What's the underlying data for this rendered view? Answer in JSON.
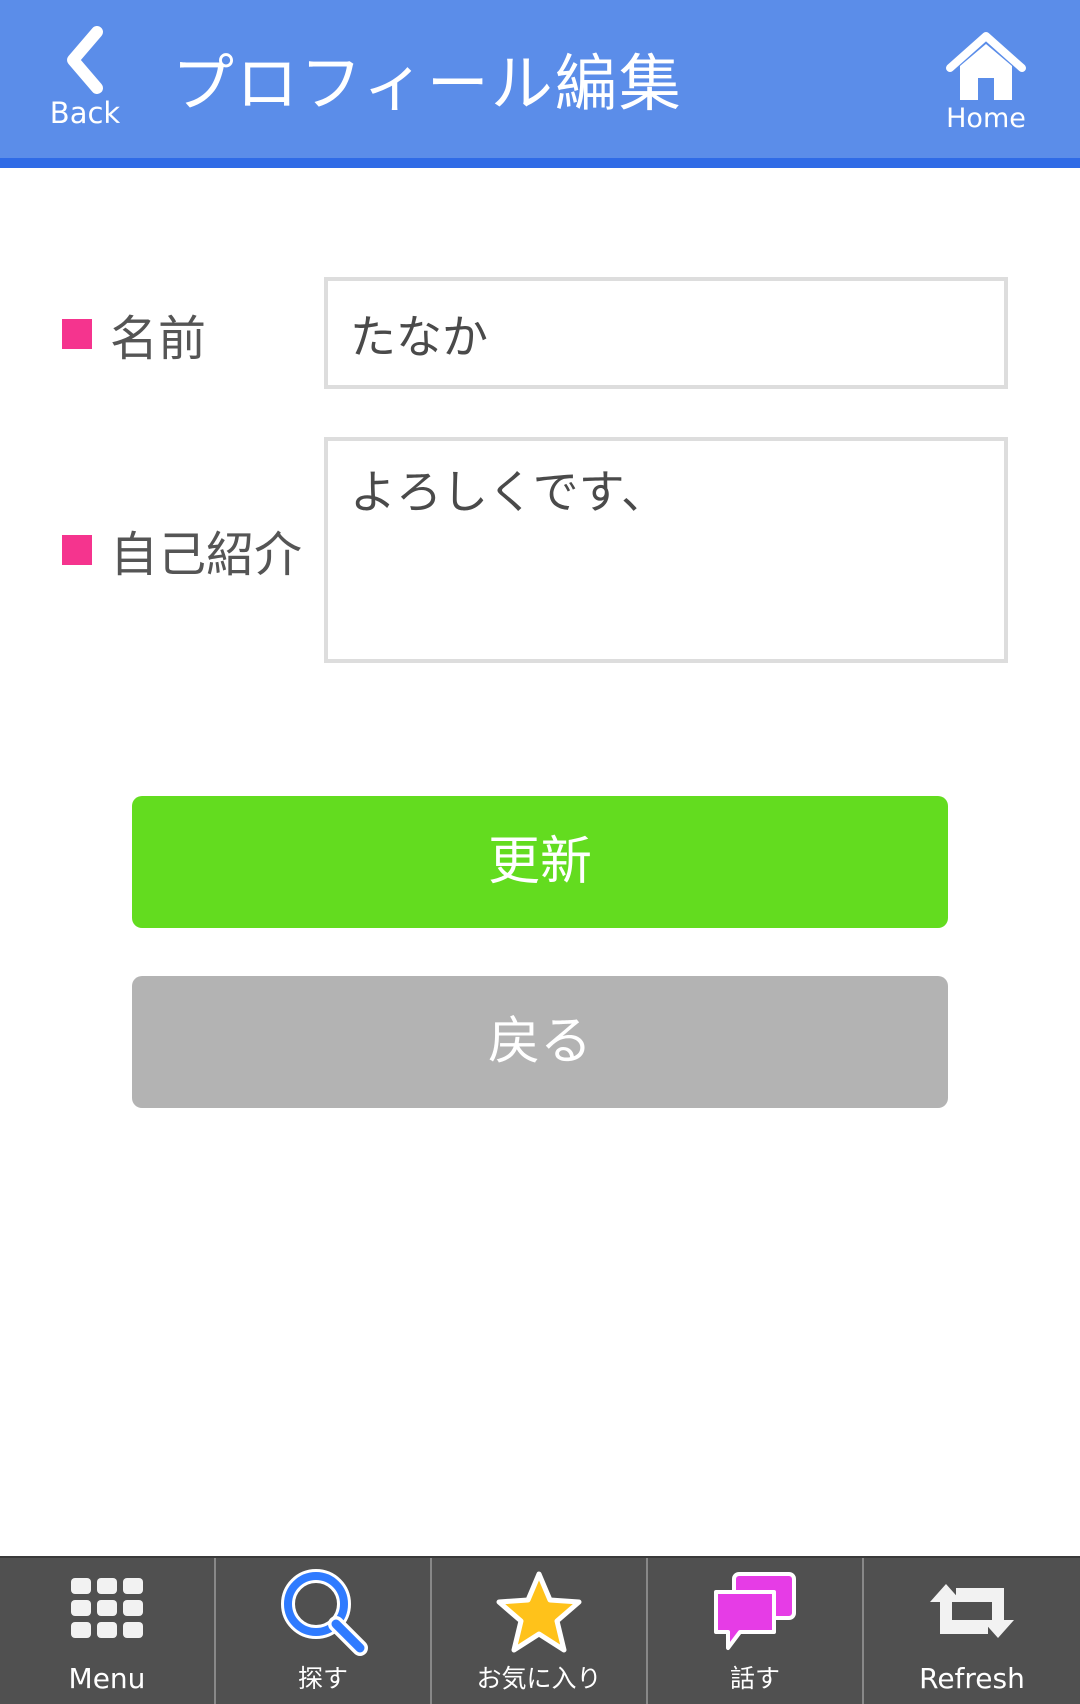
{
  "header": {
    "back_label": "Back",
    "title": "プロフィール編集",
    "home_label": "Home"
  },
  "form": {
    "name_label": "名前",
    "name_value": "たなか",
    "bio_label": "自己紹介",
    "bio_value": "よろしくです、"
  },
  "buttons": {
    "update_label": "更新",
    "back_label": "戻る"
  },
  "tabbar": {
    "items": [
      {
        "label": "Menu",
        "icon": "grid-icon"
      },
      {
        "label": "探す",
        "icon": "search-icon"
      },
      {
        "label": "お気に入り",
        "icon": "star-icon"
      },
      {
        "label": "話す",
        "icon": "chat-icon"
      },
      {
        "label": "Refresh",
        "icon": "refresh-icon"
      }
    ]
  },
  "colors": {
    "header_bg": "#5b8de9",
    "header_border": "#2f6be6",
    "label_marker": "#f5348e",
    "update_button": "#63dc1f",
    "back_button": "#b3b3b3",
    "tabbar_bg": "#505050",
    "search_icon": "#2f7bff",
    "star_icon": "#ffc21a",
    "chat_icon": "#e63ce6"
  }
}
